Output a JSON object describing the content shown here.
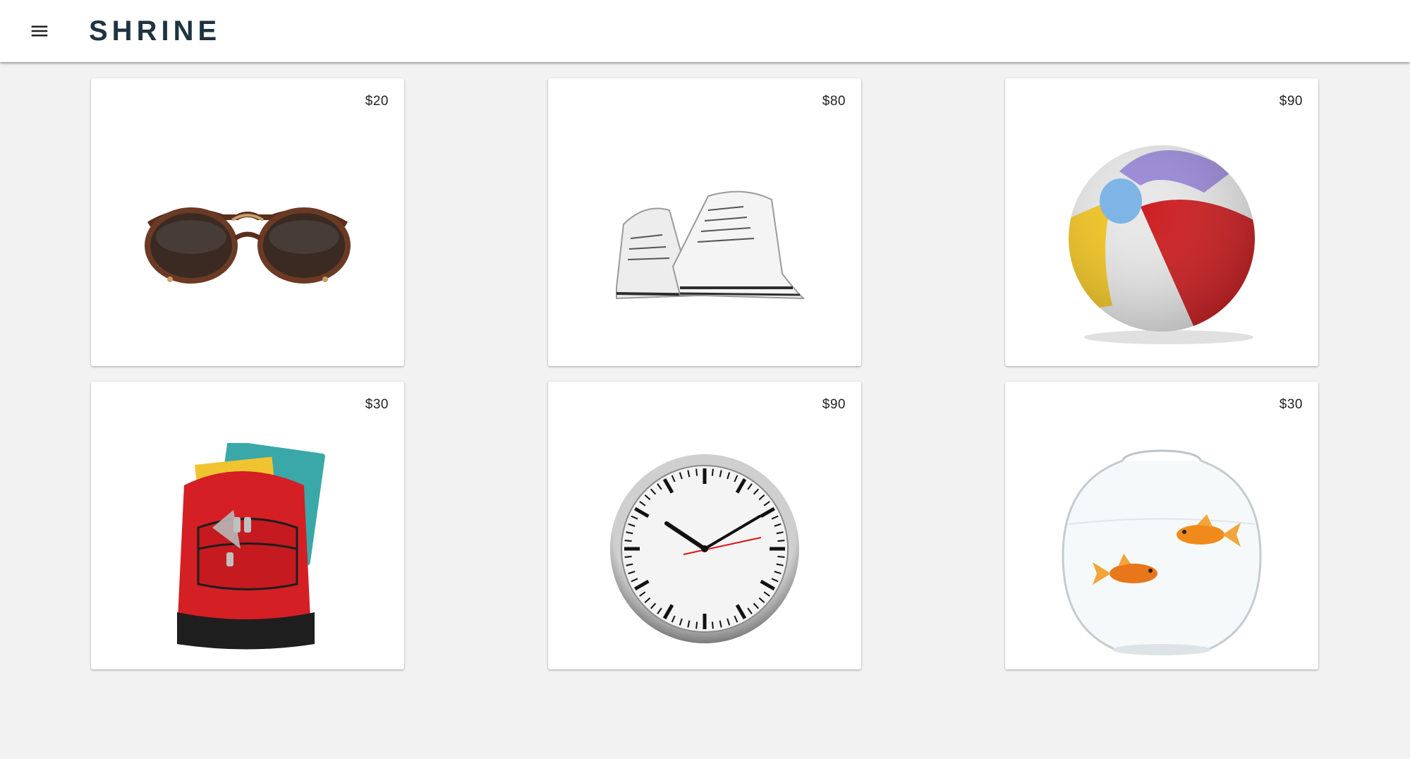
{
  "app": {
    "title": "SHRINE",
    "menu_icon": "menu-icon"
  },
  "products": [
    {
      "price": "$20",
      "image": "sunglasses"
    },
    {
      "price": "$80",
      "image": "sneakers"
    },
    {
      "price": "$90",
      "image": "beach-ball"
    },
    {
      "price": "$30",
      "image": "backpack"
    },
    {
      "price": "$90",
      "image": "wall-clock"
    },
    {
      "price": "$30",
      "image": "fishbowl"
    }
  ],
  "colors": {
    "background": "#f2f2f2",
    "card": "#ffffff",
    "title": "#1f3340",
    "price": "#222222"
  }
}
